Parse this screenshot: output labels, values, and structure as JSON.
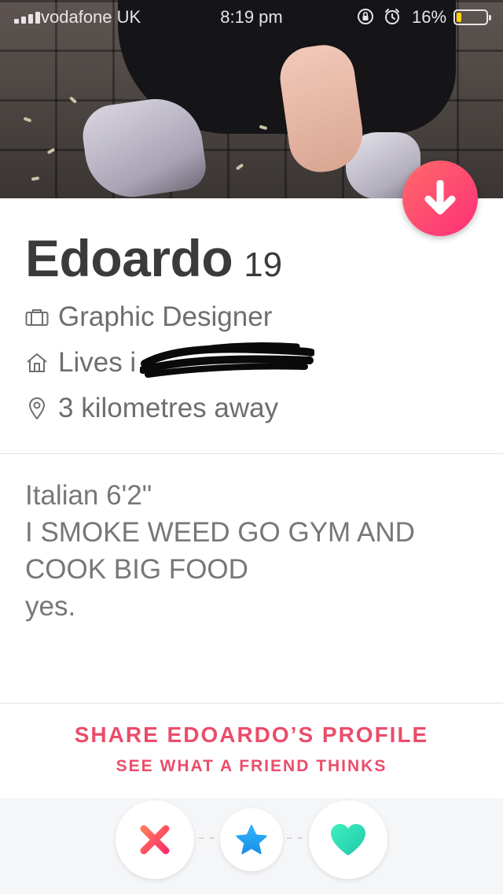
{
  "status_bar": {
    "carrier": "vodafone UK",
    "time": "8:19 pm",
    "battery_percent": "16%",
    "battery_level": 0.16,
    "battery_color": "#ffd200"
  },
  "photo": {
    "collapse_button_icon": "arrow-down-icon"
  },
  "profile": {
    "name": "Edoardo",
    "age": "19",
    "job": "Graphic Designer",
    "lives_prefix": "Lives i",
    "distance": "3 kilometres away"
  },
  "bio": {
    "lines": [
      "Italian 6'2\"",
      "I SMOKE WEED GO GYM AND",
      "COOK BIG FOOD",
      "yes."
    ]
  },
  "share": {
    "title": "SHARE EDOARDO’S PROFILE",
    "subtitle": "SEE WHAT A FRIEND THINKS"
  },
  "actions": {
    "nope_icon": "x-icon",
    "super_like_icon": "star-icon",
    "like_icon": "heart-icon"
  },
  "colors": {
    "accent": "#ea4d6a",
    "nope": "#fd5068",
    "super_like": "#1ca4f4",
    "like": "#24e0a0"
  }
}
